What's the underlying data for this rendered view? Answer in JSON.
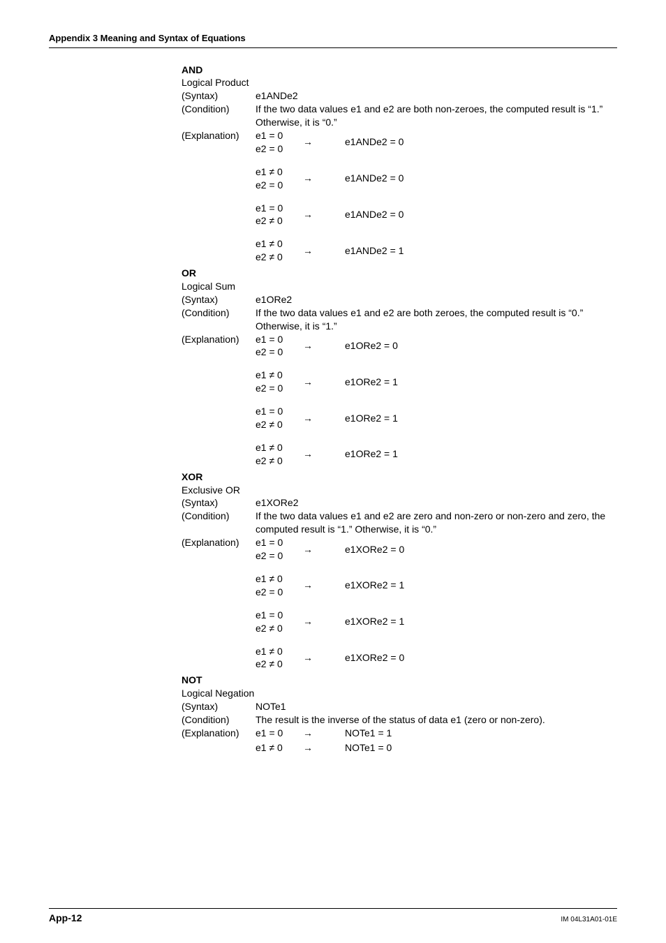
{
  "page_header": "Appendix 3  Meaning and Syntax of Equations",
  "operators": {
    "and": {
      "name": "AND",
      "desc": "Logical Product",
      "syntax_label": "(Syntax)",
      "syntax": "e1ANDe2",
      "cond_label": "(Condition)",
      "cond": "If the two data values e1 and e2 are both non-zeroes, the computed result is “1.”  Otherwise, it is “0.”",
      "expl_label": "(Explanation)",
      "rows": [
        {
          "a": "e1 = 0",
          "b": "e2 = 0",
          "r": "e1ANDe2 = 0"
        },
        {
          "a": "e1 ≠ 0",
          "b": "e2 = 0",
          "r": "e1ANDe2 = 0"
        },
        {
          "a": "e1 = 0",
          "b": "e2 ≠ 0",
          "r": "e1ANDe2 = 0"
        },
        {
          "a": "e1 ≠ 0",
          "b": "e2 ≠ 0",
          "r": "e1ANDe2 = 1"
        }
      ]
    },
    "or": {
      "name": "OR",
      "desc": "Logical Sum",
      "syntax_label": "(Syntax)",
      "syntax": "e1ORe2",
      "cond_label": "(Condition)",
      "cond": "If the two data values e1 and e2 are both zeroes, the computed result is “0.”  Otherwise, it is “1.”",
      "expl_label": "(Explanation)",
      "rows": [
        {
          "a": "e1 = 0",
          "b": "e2 = 0",
          "r": "e1ORe2 = 0"
        },
        {
          "a": "e1 ≠ 0",
          "b": "e2 = 0",
          "r": "e1ORe2 = 1"
        },
        {
          "a": "e1 = 0",
          "b": "e2 ≠ 0",
          "r": "e1ORe2 = 1"
        },
        {
          "a": "e1 ≠ 0",
          "b": "e2 ≠ 0",
          "r": "e1ORe2 = 1"
        }
      ]
    },
    "xor": {
      "name": "XOR",
      "desc": "Exclusive OR",
      "syntax_label": "(Syntax)",
      "syntax": "e1XORe2",
      "cond_label": "(Condition)",
      "cond": "If the two data values e1 and e2 are zero and non-zero or non-zero and zero, the computed result is “1.”  Otherwise, it is “0.”",
      "expl_label": "(Explanation)",
      "rows": [
        {
          "a": "e1 = 0",
          "b": "e2 = 0",
          "r": "e1XORe2 = 0"
        },
        {
          "a": "e1 ≠ 0",
          "b": "e2 = 0",
          "r": "e1XORe2 = 1"
        },
        {
          "a": "e1 = 0",
          "b": "e2 ≠ 0",
          "r": "e1XORe2 = 1"
        },
        {
          "a": "e1 ≠ 0",
          "b": "e2 ≠ 0",
          "r": "e1XORe2 = 0"
        }
      ]
    },
    "not": {
      "name": "NOT",
      "desc": "Logical Negation",
      "syntax_label": "(Syntax)",
      "syntax": "NOTe1",
      "cond_label": "(Condition)",
      "cond": "The result is the inverse of the status of data e1 (zero or non-zero).",
      "expl_label": "(Explanation)",
      "rows": [
        {
          "a": "e1 = 0",
          "r": "NOTe1 = 1"
        },
        {
          "a": "e1 ≠ 0",
          "r": "NOTe1 = 0"
        }
      ]
    }
  },
  "arrow": "→",
  "footer": {
    "page": "App-12",
    "doc": "IM 04L31A01-01E"
  }
}
